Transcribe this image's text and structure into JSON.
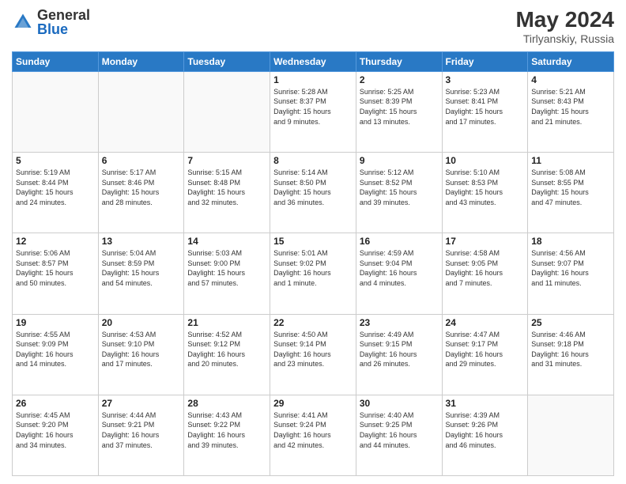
{
  "header": {
    "logo_general": "General",
    "logo_blue": "Blue",
    "month_year": "May 2024",
    "location": "Tirlyanskiy, Russia"
  },
  "days_of_week": [
    "Sunday",
    "Monday",
    "Tuesday",
    "Wednesday",
    "Thursday",
    "Friday",
    "Saturday"
  ],
  "weeks": [
    [
      {
        "day": "",
        "info": ""
      },
      {
        "day": "",
        "info": ""
      },
      {
        "day": "",
        "info": ""
      },
      {
        "day": "1",
        "info": "Sunrise: 5:28 AM\nSunset: 8:37 PM\nDaylight: 15 hours\nand 9 minutes."
      },
      {
        "day": "2",
        "info": "Sunrise: 5:25 AM\nSunset: 8:39 PM\nDaylight: 15 hours\nand 13 minutes."
      },
      {
        "day": "3",
        "info": "Sunrise: 5:23 AM\nSunset: 8:41 PM\nDaylight: 15 hours\nand 17 minutes."
      },
      {
        "day": "4",
        "info": "Sunrise: 5:21 AM\nSunset: 8:43 PM\nDaylight: 15 hours\nand 21 minutes."
      }
    ],
    [
      {
        "day": "5",
        "info": "Sunrise: 5:19 AM\nSunset: 8:44 PM\nDaylight: 15 hours\nand 24 minutes."
      },
      {
        "day": "6",
        "info": "Sunrise: 5:17 AM\nSunset: 8:46 PM\nDaylight: 15 hours\nand 28 minutes."
      },
      {
        "day": "7",
        "info": "Sunrise: 5:15 AM\nSunset: 8:48 PM\nDaylight: 15 hours\nand 32 minutes."
      },
      {
        "day": "8",
        "info": "Sunrise: 5:14 AM\nSunset: 8:50 PM\nDaylight: 15 hours\nand 36 minutes."
      },
      {
        "day": "9",
        "info": "Sunrise: 5:12 AM\nSunset: 8:52 PM\nDaylight: 15 hours\nand 39 minutes."
      },
      {
        "day": "10",
        "info": "Sunrise: 5:10 AM\nSunset: 8:53 PM\nDaylight: 15 hours\nand 43 minutes."
      },
      {
        "day": "11",
        "info": "Sunrise: 5:08 AM\nSunset: 8:55 PM\nDaylight: 15 hours\nand 47 minutes."
      }
    ],
    [
      {
        "day": "12",
        "info": "Sunrise: 5:06 AM\nSunset: 8:57 PM\nDaylight: 15 hours\nand 50 minutes."
      },
      {
        "day": "13",
        "info": "Sunrise: 5:04 AM\nSunset: 8:59 PM\nDaylight: 15 hours\nand 54 minutes."
      },
      {
        "day": "14",
        "info": "Sunrise: 5:03 AM\nSunset: 9:00 PM\nDaylight: 15 hours\nand 57 minutes."
      },
      {
        "day": "15",
        "info": "Sunrise: 5:01 AM\nSunset: 9:02 PM\nDaylight: 16 hours\nand 1 minute."
      },
      {
        "day": "16",
        "info": "Sunrise: 4:59 AM\nSunset: 9:04 PM\nDaylight: 16 hours\nand 4 minutes."
      },
      {
        "day": "17",
        "info": "Sunrise: 4:58 AM\nSunset: 9:05 PM\nDaylight: 16 hours\nand 7 minutes."
      },
      {
        "day": "18",
        "info": "Sunrise: 4:56 AM\nSunset: 9:07 PM\nDaylight: 16 hours\nand 11 minutes."
      }
    ],
    [
      {
        "day": "19",
        "info": "Sunrise: 4:55 AM\nSunset: 9:09 PM\nDaylight: 16 hours\nand 14 minutes."
      },
      {
        "day": "20",
        "info": "Sunrise: 4:53 AM\nSunset: 9:10 PM\nDaylight: 16 hours\nand 17 minutes."
      },
      {
        "day": "21",
        "info": "Sunrise: 4:52 AM\nSunset: 9:12 PM\nDaylight: 16 hours\nand 20 minutes."
      },
      {
        "day": "22",
        "info": "Sunrise: 4:50 AM\nSunset: 9:14 PM\nDaylight: 16 hours\nand 23 minutes."
      },
      {
        "day": "23",
        "info": "Sunrise: 4:49 AM\nSunset: 9:15 PM\nDaylight: 16 hours\nand 26 minutes."
      },
      {
        "day": "24",
        "info": "Sunrise: 4:47 AM\nSunset: 9:17 PM\nDaylight: 16 hours\nand 29 minutes."
      },
      {
        "day": "25",
        "info": "Sunrise: 4:46 AM\nSunset: 9:18 PM\nDaylight: 16 hours\nand 31 minutes."
      }
    ],
    [
      {
        "day": "26",
        "info": "Sunrise: 4:45 AM\nSunset: 9:20 PM\nDaylight: 16 hours\nand 34 minutes."
      },
      {
        "day": "27",
        "info": "Sunrise: 4:44 AM\nSunset: 9:21 PM\nDaylight: 16 hours\nand 37 minutes."
      },
      {
        "day": "28",
        "info": "Sunrise: 4:43 AM\nSunset: 9:22 PM\nDaylight: 16 hours\nand 39 minutes."
      },
      {
        "day": "29",
        "info": "Sunrise: 4:41 AM\nSunset: 9:24 PM\nDaylight: 16 hours\nand 42 minutes."
      },
      {
        "day": "30",
        "info": "Sunrise: 4:40 AM\nSunset: 9:25 PM\nDaylight: 16 hours\nand 44 minutes."
      },
      {
        "day": "31",
        "info": "Sunrise: 4:39 AM\nSunset: 9:26 PM\nDaylight: 16 hours\nand 46 minutes."
      },
      {
        "day": "",
        "info": ""
      }
    ]
  ]
}
